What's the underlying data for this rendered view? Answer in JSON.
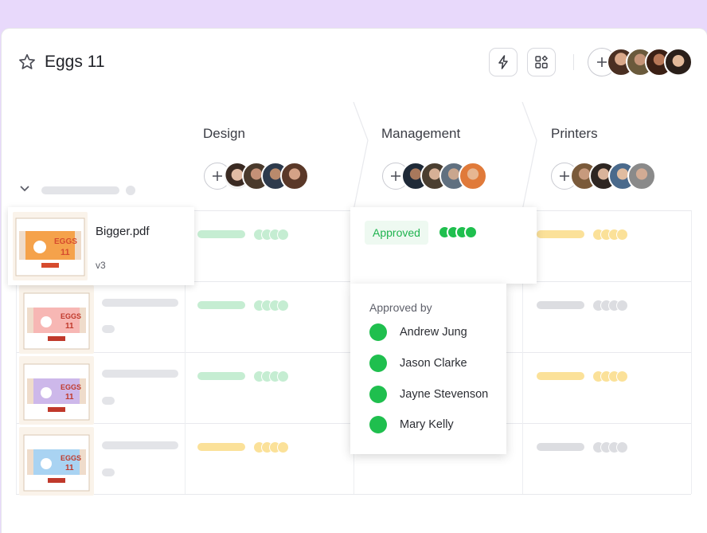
{
  "header": {
    "title": "Eggs 11",
    "lightning_icon": "lightning-icon",
    "apps_icon": "apps-icon",
    "add_member_icon": "plus-icon"
  },
  "columns": [
    {
      "title": "Design"
    },
    {
      "title": "Management"
    },
    {
      "title": "Printers"
    }
  ],
  "file": {
    "name": "Bigger.pdf",
    "version": "v3",
    "thumbnail_text": "EGGS 11"
  },
  "management": {
    "status": "Approved"
  },
  "approval_popup": {
    "heading": "Approved by",
    "approvers": [
      "Andrew Jung",
      "Jason Clarke",
      "Jayne Stevenson",
      "Mary Kelly"
    ]
  },
  "colors": {
    "approved_green": "#1fbf4e",
    "light_green": "#c5edd2",
    "yellow": "#fbe199",
    "gray": "#dcdde1",
    "background": "#e8d9fb"
  }
}
